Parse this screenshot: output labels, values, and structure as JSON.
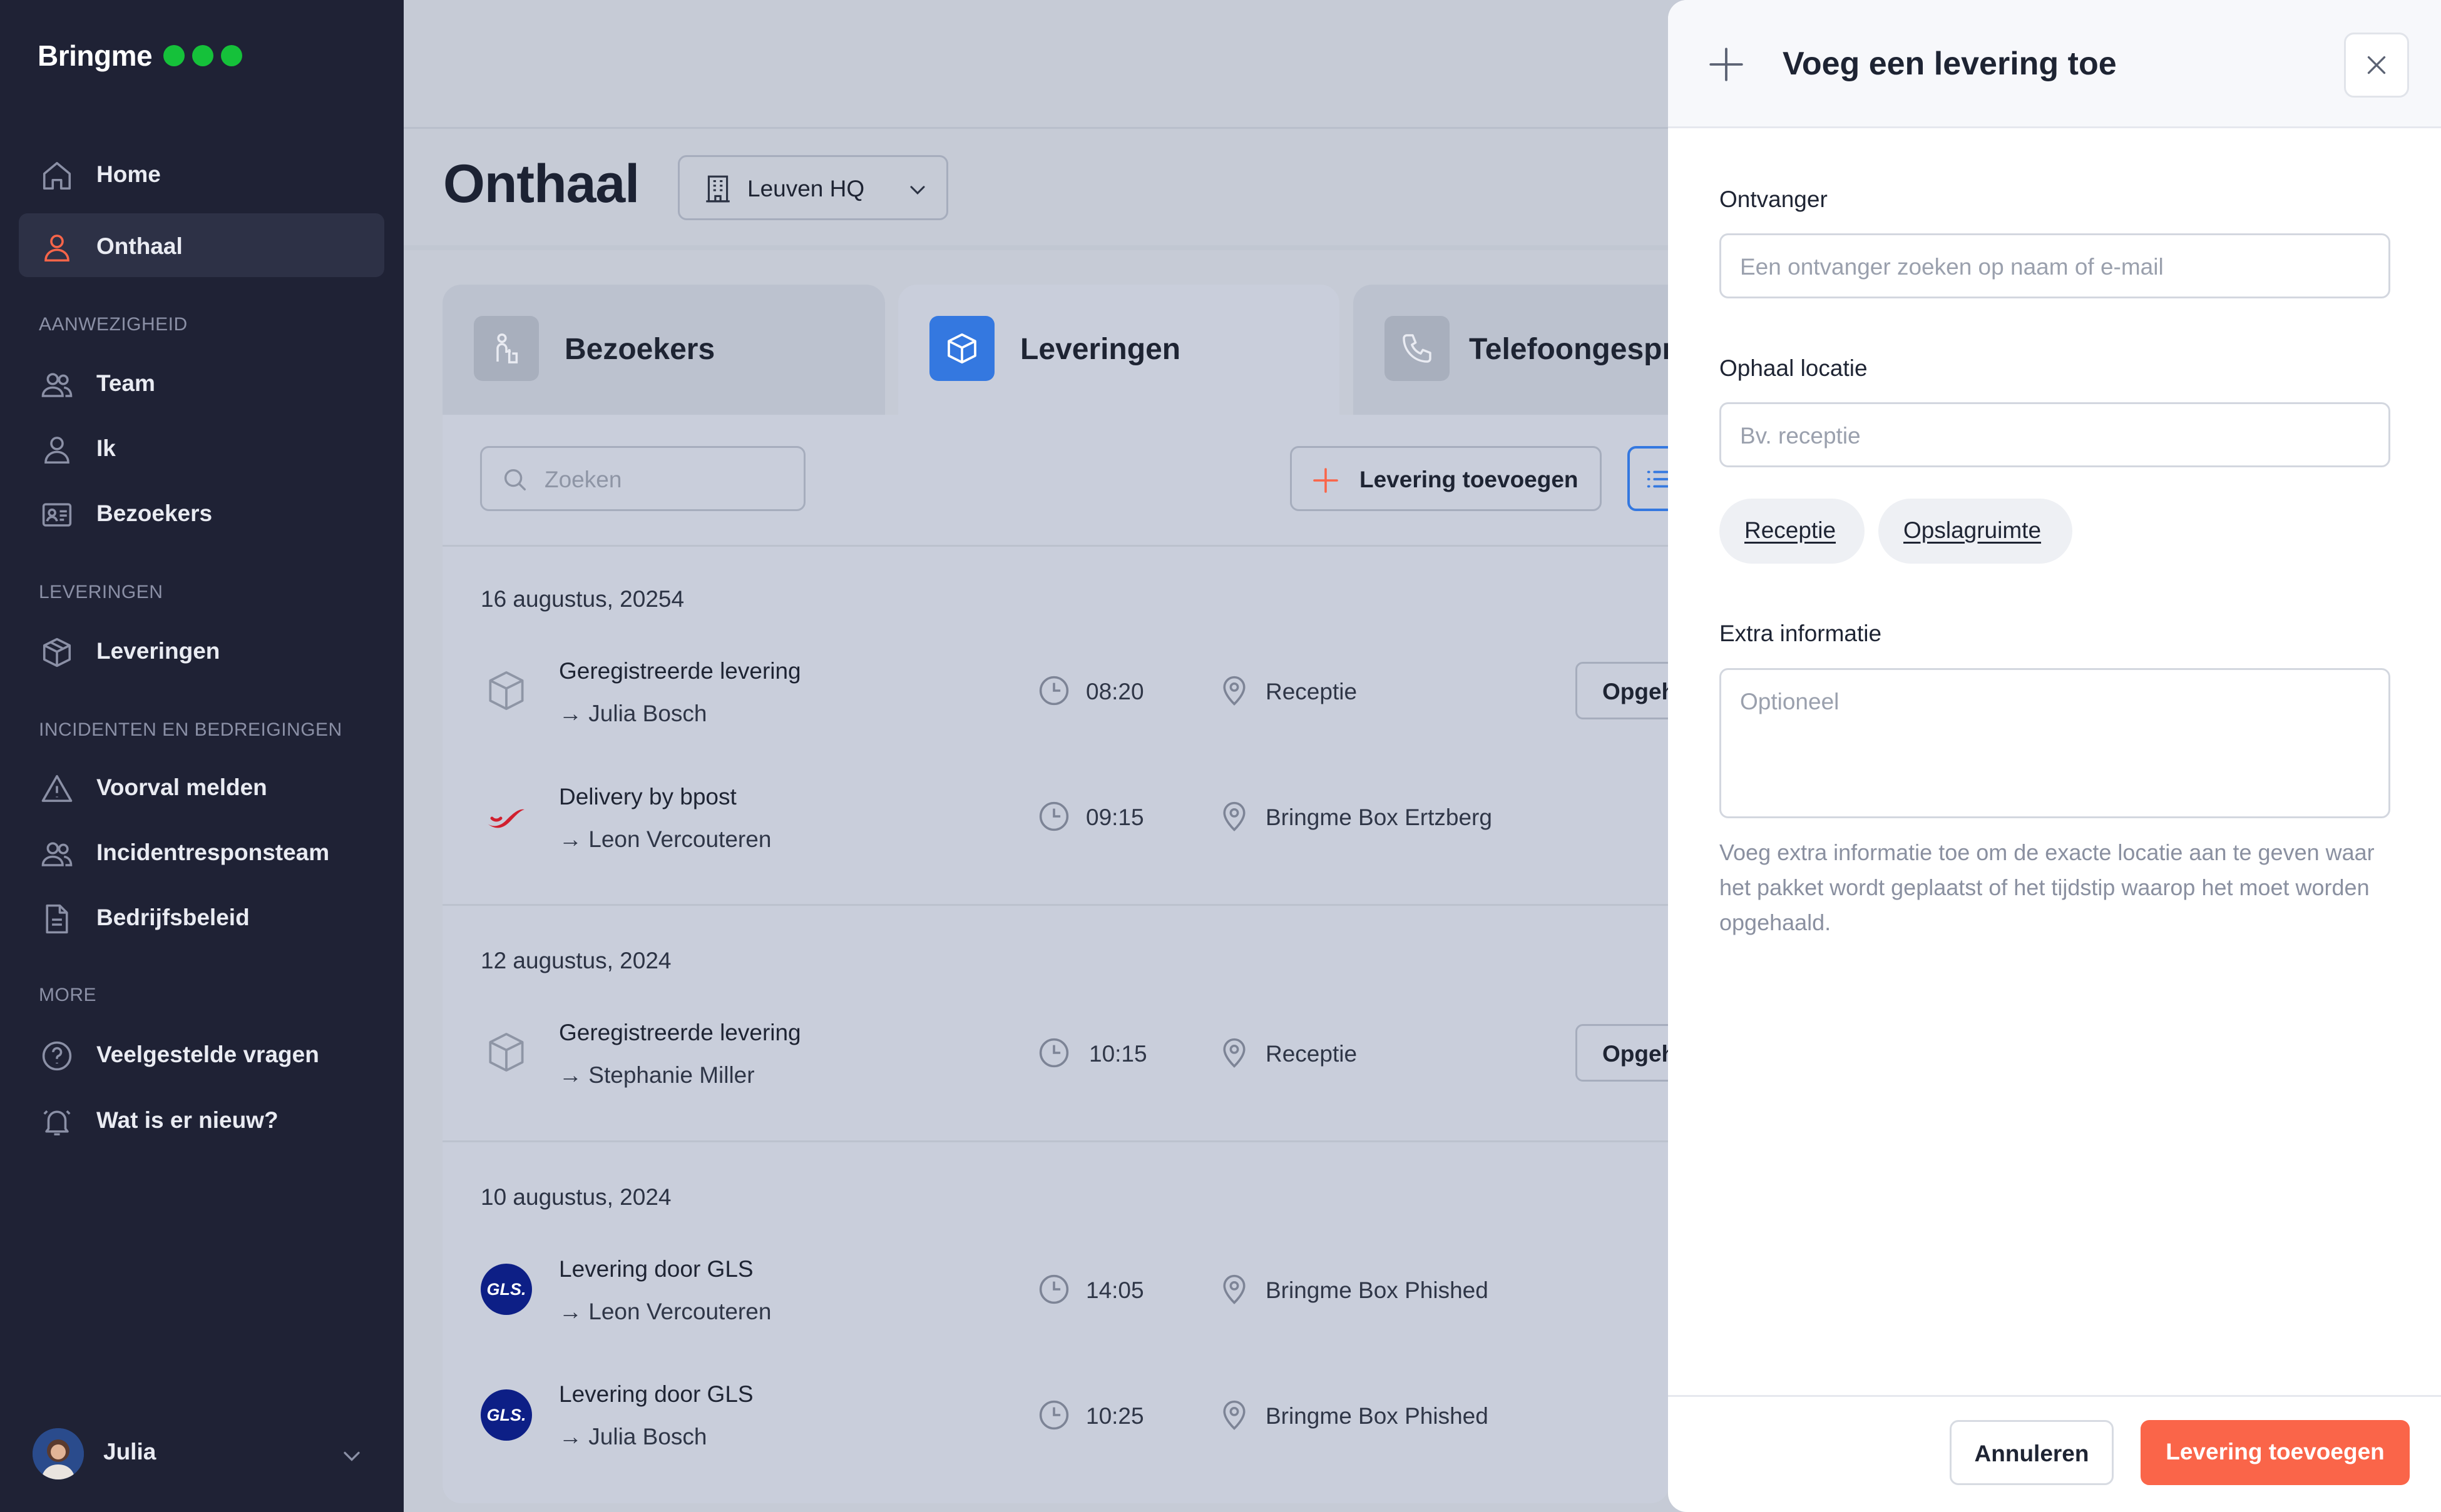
{
  "app": {
    "logo": "Bringme",
    "status_color": "#15c13a"
  },
  "sidebar": {
    "items": [
      {
        "label": "Home",
        "icon": "home-icon"
      },
      {
        "label": "Onthaal",
        "icon": "person-icon",
        "active": true
      }
    ],
    "sections": [
      {
        "title": "AANWEZIGHEID",
        "items": [
          {
            "label": "Team"
          },
          {
            "label": "Ik"
          },
          {
            "label": "Bezoekers"
          }
        ]
      },
      {
        "title": "LEVERINGEN",
        "items": [
          {
            "label": "Leveringen"
          }
        ]
      },
      {
        "title": "INCIDENTEN EN BEDREIGINGEN",
        "items": [
          {
            "label": "Voorval melden"
          },
          {
            "label": "Incidentresponsteam"
          },
          {
            "label": "Bedrijfsbeleid"
          }
        ]
      },
      {
        "title": "MORE",
        "items": [
          {
            "label": "Veelgestelde vragen"
          },
          {
            "label": "Wat is er nieuw?"
          }
        ]
      }
    ],
    "user": {
      "name": "Julia"
    }
  },
  "header": {
    "title": "Onthaal",
    "location": "Leuven HQ"
  },
  "tabs": [
    {
      "label": "Bezoekers",
      "active": false
    },
    {
      "label": "Leveringen",
      "active": true
    },
    {
      "label": "Telefoongespr"
    }
  ],
  "toolbar": {
    "search_placeholder": "Zoeken",
    "add_label": "Levering toevoegen"
  },
  "deliveries": {
    "groups": [
      {
        "date": "16 augustus, 20254",
        "items": [
          {
            "title": "Geregistreerde levering",
            "recipient": "→ Julia Bosch",
            "time": "08:20",
            "location": "Receptie",
            "action": "Opgehaald"
          },
          {
            "title": "Delivery by bpost",
            "recipient": "→ Leon Vercouteren",
            "time": "09:15",
            "location": "Bringme Box Ertzberg"
          }
        ]
      },
      {
        "date": "12 augustus, 2024",
        "items": [
          {
            "title": "Geregistreerde levering",
            "recipient": "→ Stephanie Miller",
            "time": "10:15",
            "location": "Receptie",
            "action": "Opgehaald"
          }
        ]
      },
      {
        "date": "10 augustus, 2024",
        "items": [
          {
            "title": "Levering door GLS",
            "recipient": "→ Leon Vercouteren",
            "time": "14:05",
            "location": "Bringme Box Phished",
            "logo": "GLS."
          },
          {
            "title": "Levering door GLS",
            "recipient": "→ Julia Bosch",
            "time": "10:25",
            "location": "Bringme Box Phished",
            "logo": "GLS."
          }
        ]
      }
    ]
  },
  "drawer": {
    "title": "Voeg een levering toe",
    "recipient": {
      "label": "Ontvanger",
      "placeholder": "Een ontvanger zoeken op naam of e-mail"
    },
    "pickup": {
      "label": "Ophaal locatie",
      "placeholder": "Bv. receptie",
      "chips": [
        "Receptie",
        "Opslagruimte"
      ]
    },
    "extra": {
      "label": "Extra informatie",
      "placeholder": "Optioneel",
      "help": "Voeg extra informatie toe om de exacte locatie aan te geven waar het pakket wordt geplaatst of het tijdstip waarop het moet worden opgehaald."
    },
    "cancel_label": "Annuleren",
    "submit_label": "Levering toevoegen",
    "accent": "#fa6549"
  }
}
